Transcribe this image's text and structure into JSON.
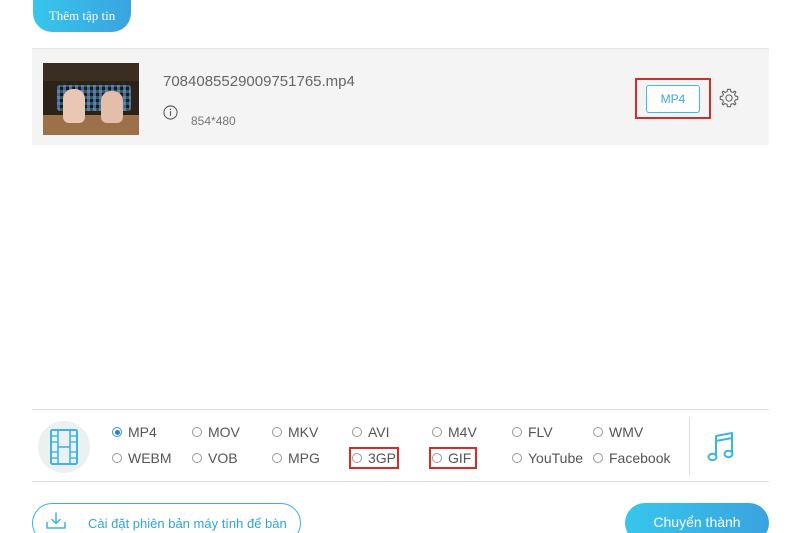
{
  "header": {
    "add_file_label": "Thêm tập tin"
  },
  "file": {
    "name": "7084085529009751765.mp4",
    "resolution": "854*480",
    "output_format": "MP4"
  },
  "formats": {
    "options": [
      {
        "label": "MP4",
        "checked": true
      },
      {
        "label": "MOV",
        "checked": false
      },
      {
        "label": "MKV",
        "checked": false
      },
      {
        "label": "AVI",
        "checked": false
      },
      {
        "label": "M4V",
        "checked": false
      },
      {
        "label": "FLV",
        "checked": false
      },
      {
        "label": "WMV",
        "checked": false
      },
      {
        "label": "WEBM",
        "checked": false
      },
      {
        "label": "VOB",
        "checked": false
      },
      {
        "label": "MPG",
        "checked": false
      },
      {
        "label": "3GP",
        "checked": false
      },
      {
        "label": "GIF",
        "checked": false
      },
      {
        "label": "YouTube",
        "checked": false
      },
      {
        "label": "Facebook",
        "checked": false
      }
    ],
    "highlighted": [
      "3GP",
      "GIF"
    ]
  },
  "footer": {
    "download_label": "Cài đặt phiên bản máy tính để bàn",
    "convert_label": "Chuyển thành"
  },
  "colors": {
    "accent": "#35a9df",
    "highlight": "#d42c2c"
  },
  "icons": {
    "info": "info-icon",
    "settings": "gear-icon",
    "video": "film-icon",
    "audio": "music-note-icon",
    "download": "download-icon"
  }
}
